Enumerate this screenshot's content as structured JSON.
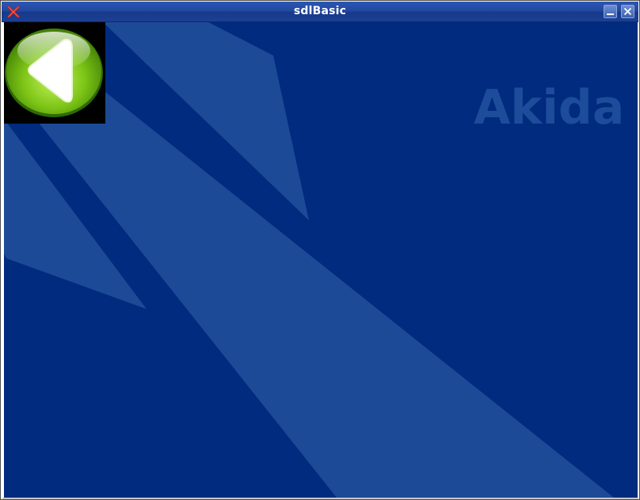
{
  "window": {
    "title": "sdlBasic"
  },
  "background": {
    "base_color": "#002b7f",
    "stripe_color": "#1c4a96",
    "watermark_text": "Akida",
    "watermark_color": "#1d4c9a"
  },
  "back_button": {
    "icon": "back-arrow-icon",
    "accent_color": "#7cc416"
  },
  "titlebar_buttons": {
    "minimize": "minimize-icon",
    "close": "close-icon"
  }
}
